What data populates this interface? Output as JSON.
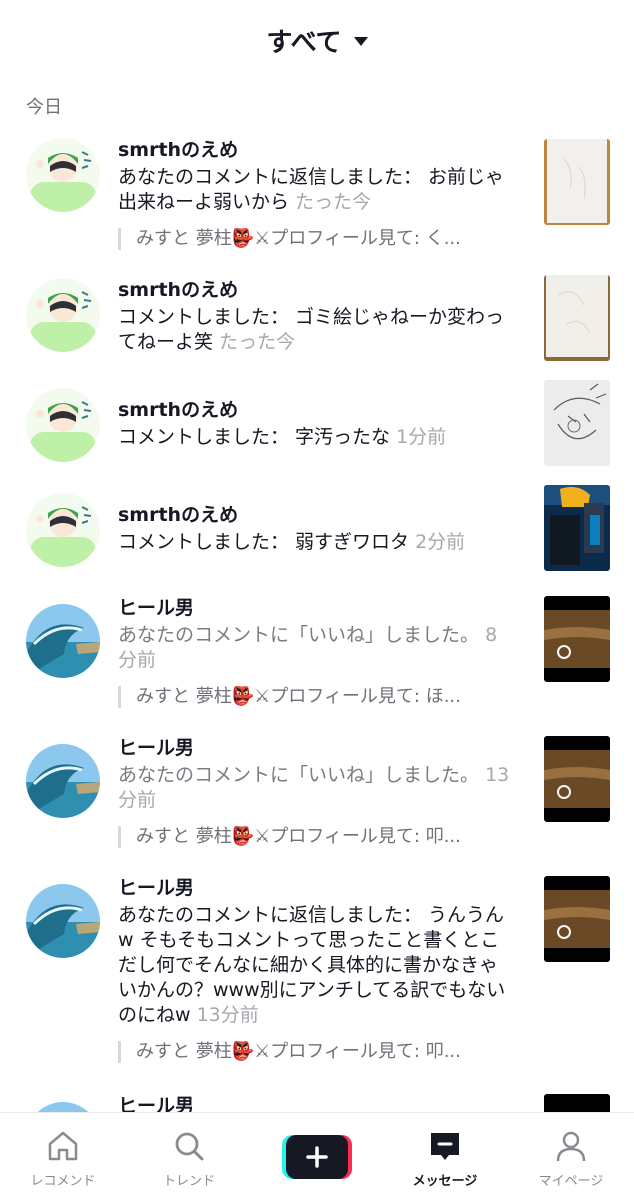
{
  "header": {
    "title": "すべて"
  },
  "section": {
    "today": "今日"
  },
  "notifications": [
    {
      "username": "smrthのえめ",
      "message": "あなたのコメントに返信しました： お前じゃ出来ねーよ弱いから",
      "time": "たった今",
      "quote": "みすと 夢柱👺⚔プロフィール見て: く..."
    },
    {
      "username": "smrthのえめ",
      "message": "コメントしました： ゴミ絵じゃねーか変わってねーよ笑",
      "time": "たった今"
    },
    {
      "username": "smrthのえめ",
      "message": "コメントしました： 字汚ったな",
      "time": "1分前"
    },
    {
      "username": "smrthのえめ",
      "message": "コメントしました： 弱すぎワロタ",
      "time": "2分前"
    },
    {
      "username": "ヒール男",
      "message": "あなたのコメントに「いいね」しました。",
      "time": "8分前",
      "quote": "みすと 夢柱👺⚔プロフィール見て: ほ..."
    },
    {
      "username": "ヒール男",
      "message": "あなたのコメントに「いいね」しました。",
      "time": "13分前",
      "quote": "みすと 夢柱👺⚔プロフィール見て: 叩..."
    },
    {
      "username": "ヒール男",
      "message": "あなたのコメントに返信しました： うんうんw そもそもコメントって思ったこと書くとこだし何でそんなに細かく具体的に書かなきゃいかんの？www別にアンチしてる訳でもないのにねw",
      "time": "13分前",
      "quote": "みすと 夢柱👺⚔プロフィール見て: 叩..."
    },
    {
      "username": "ヒール男"
    }
  ],
  "tabbar": {
    "home": "レコメンド",
    "trend": "トレンド",
    "messages": "メッセージ",
    "profile": "マイページ"
  },
  "colors": {
    "accent_cyan": "#25f4ee",
    "accent_red": "#fe2c55",
    "text_primary": "#161823",
    "text_muted": "#a7a8ae"
  }
}
